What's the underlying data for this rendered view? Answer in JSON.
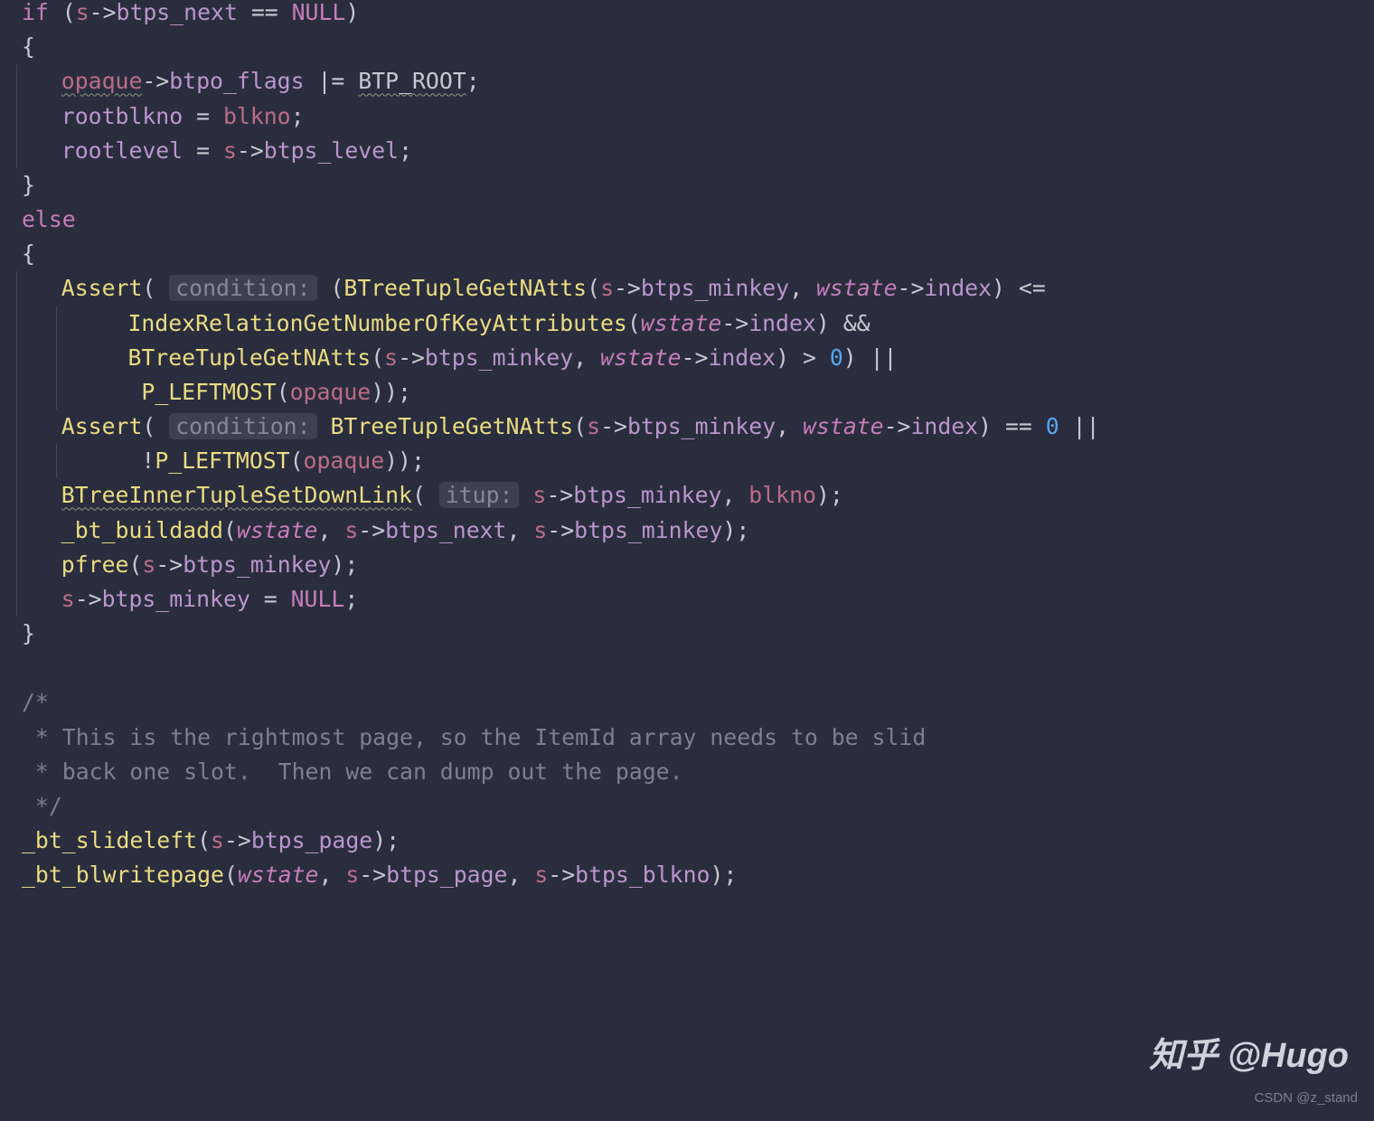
{
  "code": {
    "if": "if",
    "else": "else",
    "null": "NULL",
    "s": "s",
    "arrow": "->",
    "blkno": "blkno",
    "opaque": "opaque",
    "btps_next": "btps_next",
    "btps_level": "btps_level",
    "btps_minkey": "btps_minkey",
    "btps_page": "btps_page",
    "btps_blkno": "btps_blkno",
    "btpo_flags": "btpo_flags",
    "btp_root": "BTP_ROOT",
    "rootblkno": "rootblkno",
    "rootlevel": "rootlevel",
    "assert": "Assert",
    "cond": "condition:",
    "bttn": "BTreeTupleGetNAtts",
    "irgnka": "IndexRelationGetNumberOfKeyAttributes",
    "pleft": "P_LEFTMOST",
    "btitsdl": "BTreeInnerTupleSetDownLink",
    "itup": "itup:",
    "btbuildadd": "_bt_buildadd",
    "pfree": "pfree",
    "btslide": "_bt_slideleft",
    "btblw": "_bt_blwritepage",
    "wstate": "wstate",
    "index": "index",
    "zero": "0",
    "c1": "/*",
    "c2": " * This is the rightmost page, so the ItemId array needs to be slid",
    "c3": " * back one slot.  Then we can dump out the page.",
    "c4": " */"
  },
  "watermark": {
    "zhihu": "知乎 @Hugo",
    "csdn": "CSDN @z_stand"
  }
}
